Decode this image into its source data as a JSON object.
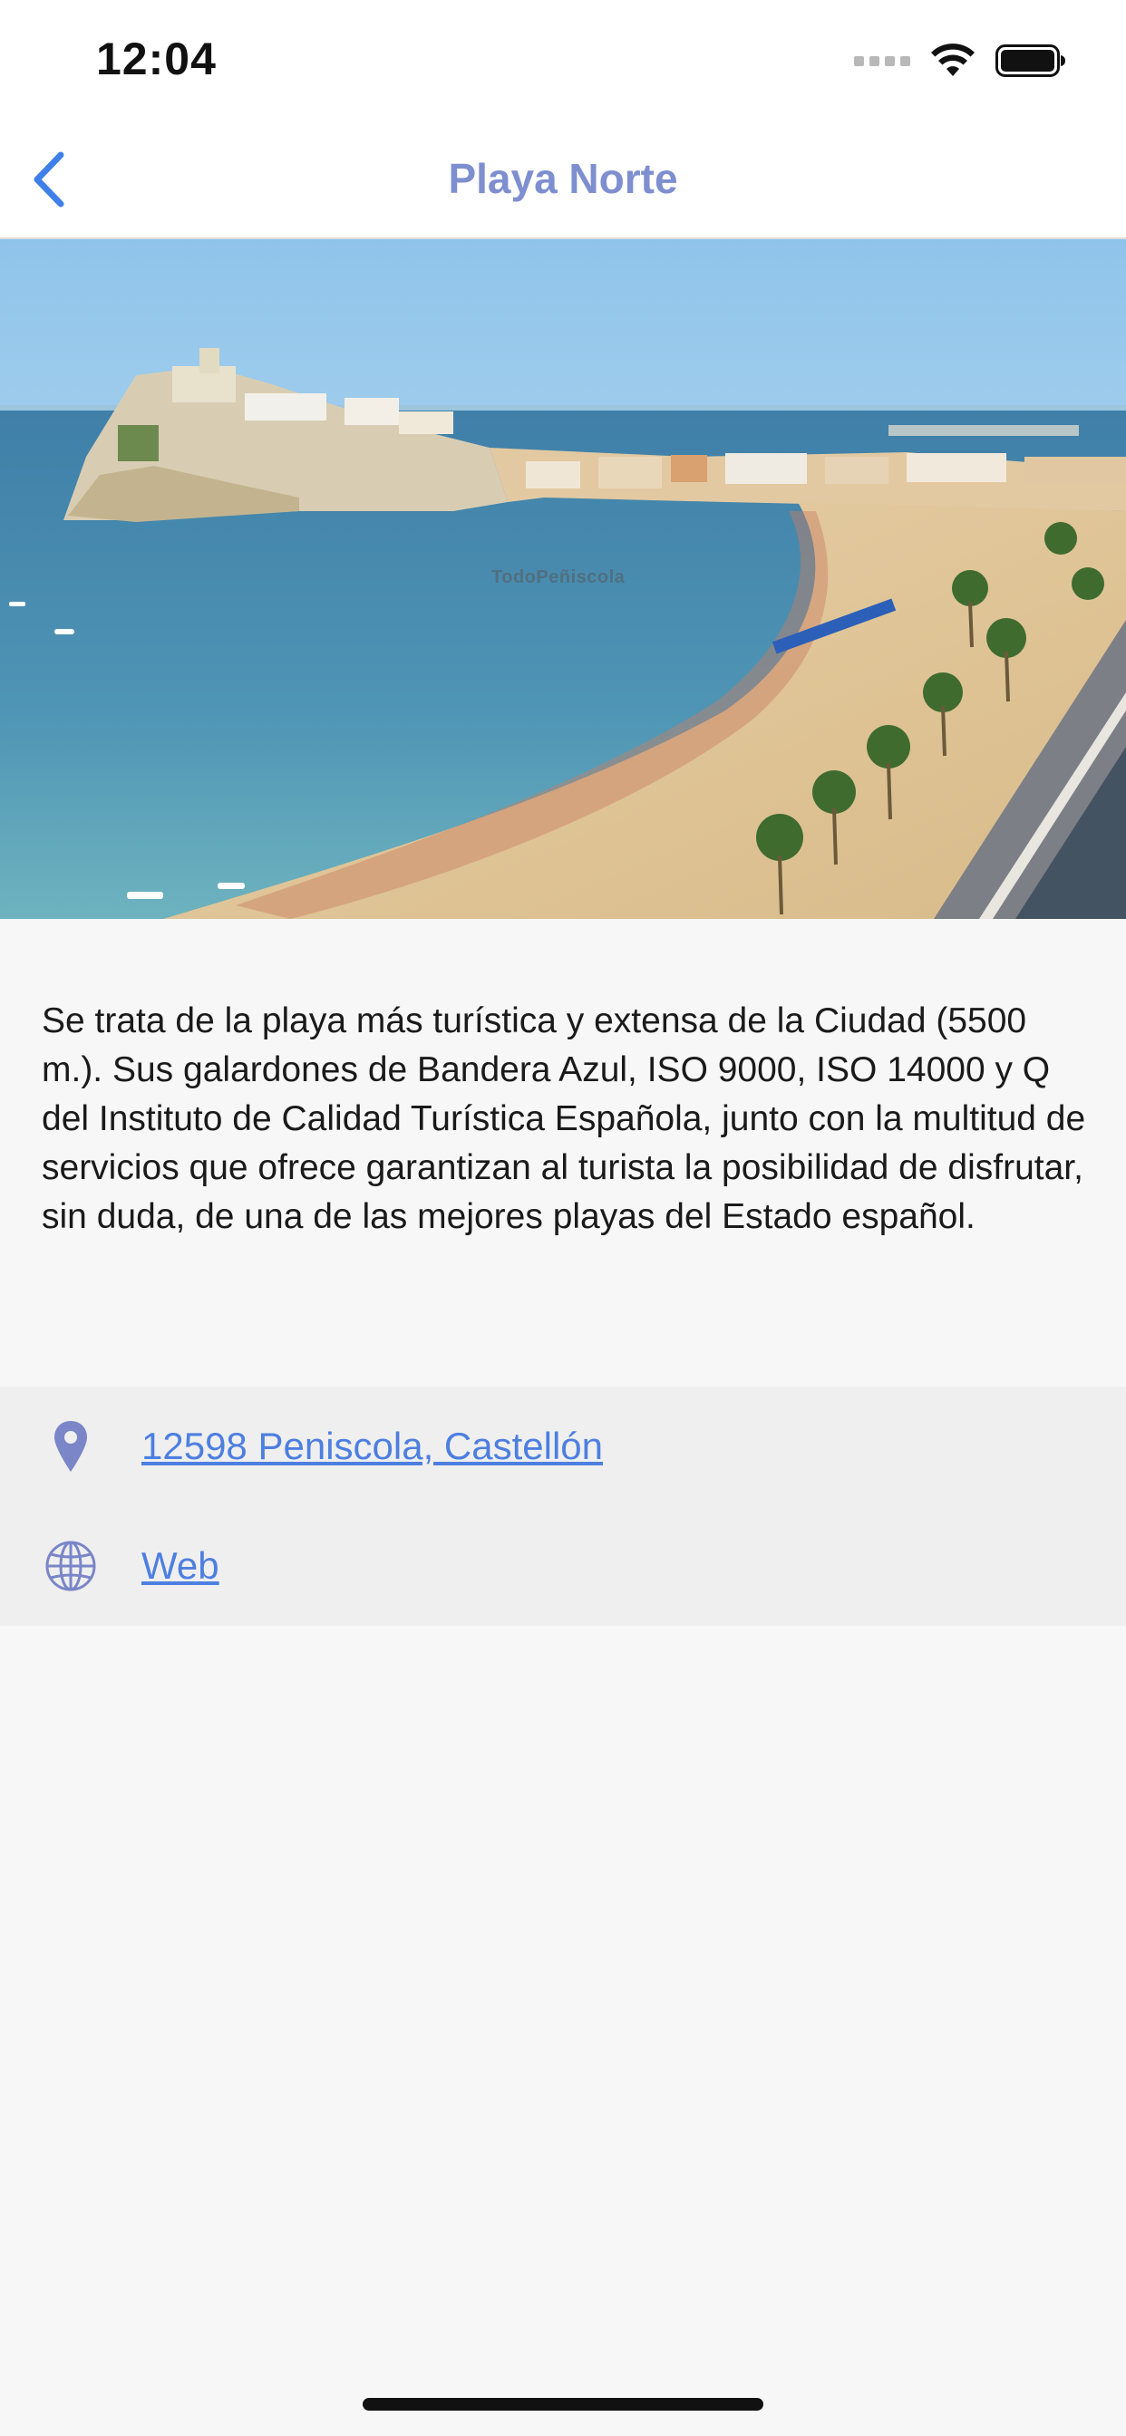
{
  "status_bar": {
    "time": "12:04",
    "icons": [
      "signal-icon",
      "wifi-icon",
      "battery-icon"
    ]
  },
  "nav": {
    "back_icon": "chevron-left-icon",
    "title": "Playa Norte"
  },
  "hero": {
    "image": "beach-photo",
    "watermark": "TodoPeñiscola"
  },
  "description": "Se trata de la playa más turística y extensa de la Ciudad (5500 m.). Sus galardones de Bandera Azul, ISO 9000, ISO 14000 y Q del Instituto de Calidad Turística Española, junto con la multitud de servicios que ofrece garantizan al turista la posibilidad de disfrutar, sin duda, de una de las mejores playas del Estado español.",
  "info": {
    "address": {
      "icon": "location-pin-icon",
      "label": "12598 Peniscola, Castellón"
    },
    "web": {
      "icon": "globe-icon",
      "label": "Web"
    }
  },
  "colors": {
    "accent": "#4d7fe0",
    "title": "#7e8fd0",
    "icon": "#7a86c7",
    "info_background": "#efefef",
    "page_background": "#f7f7f7"
  }
}
